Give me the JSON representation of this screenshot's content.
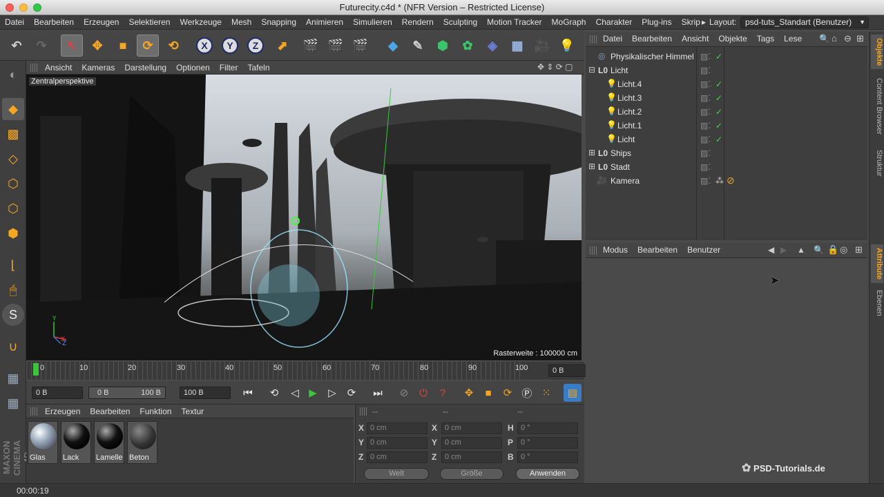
{
  "window": {
    "title": "Futurecity.c4d * (NFR Version – Restricted License)"
  },
  "menubar": {
    "items": [
      "Datei",
      "Bearbeiten",
      "Erzeugen",
      "Selektieren",
      "Werkzeuge",
      "Mesh",
      "Snapping",
      "Animieren",
      "Simulieren",
      "Rendern",
      "Sculpting",
      "Motion Tracker",
      "MoGraph",
      "Charakter",
      "Plug-ins",
      "Skrip"
    ],
    "layout_label": "Layout:",
    "layout_value": "psd-tuts_Standart (Benutzer)"
  },
  "toolbar": {
    "axis_x": "X",
    "axis_y": "Y",
    "axis_z": "Z"
  },
  "viewport": {
    "menu": [
      "Ansicht",
      "Kameras",
      "Darstellung",
      "Optionen",
      "Filter",
      "Tafeln"
    ],
    "label": "Zentralperspektive",
    "raster": "Rasterweite : 100000 cm"
  },
  "timeline": {
    "ticks": [
      "0",
      "10",
      "20",
      "30",
      "40",
      "50",
      "60",
      "70",
      "80",
      "90",
      "100"
    ],
    "current_frame": "0 B"
  },
  "controls": {
    "start": "0 B",
    "range_start": "0 B",
    "range_end": "100 B",
    "end": "100 B"
  },
  "material": {
    "menu": [
      "Erzeugen",
      "Bearbeiten",
      "Funktion",
      "Textur"
    ],
    "items": [
      {
        "name": "Glas"
      },
      {
        "name": "Lack"
      },
      {
        "name": "Lamelle"
      },
      {
        "name": "Beton"
      }
    ]
  },
  "coordinates": {
    "header": [
      "--",
      "--",
      "--"
    ],
    "rows": [
      {
        "label": "X",
        "pos": "0 cm",
        "label2": "X",
        "size": "0 cm",
        "label3": "H",
        "rot": "0 °"
      },
      {
        "label": "Y",
        "pos": "0 cm",
        "label2": "Y",
        "size": "0 cm",
        "label3": "P",
        "rot": "0 °"
      },
      {
        "label": "Z",
        "pos": "0 cm",
        "label2": "Z",
        "size": "0 cm",
        "label3": "B",
        "rot": "0 °"
      }
    ],
    "mode": "Welt",
    "size_mode": "Größe",
    "apply": "Anwenden"
  },
  "objects": {
    "menu": [
      "Datei",
      "Bearbeiten",
      "Ansicht",
      "Objekte",
      "Tags",
      "Lese"
    ],
    "items": [
      {
        "name": "Physikalischer Himmel",
        "indent": 0,
        "check": true
      },
      {
        "name": "Licht",
        "indent": 0,
        "check": false
      },
      {
        "name": "Licht.4",
        "indent": 1,
        "check": true
      },
      {
        "name": "Licht.3",
        "indent": 1,
        "check": true
      },
      {
        "name": "Licht.2",
        "indent": 1,
        "check": true
      },
      {
        "name": "Licht.1",
        "indent": 1,
        "check": true
      },
      {
        "name": "Licht",
        "indent": 1,
        "check": true
      },
      {
        "name": "Ships",
        "indent": 0,
        "check": false
      },
      {
        "name": "Stadt",
        "indent": 0,
        "check": false
      },
      {
        "name": "Kamera",
        "indent": 0,
        "check": false
      }
    ]
  },
  "attributes": {
    "menu": [
      "Modus",
      "Bearbeiten",
      "Benutzer"
    ]
  },
  "right_tabs": [
    "Objekte",
    "Content Browser",
    "Struktur",
    "Attribute",
    "Ebenen"
  ],
  "status": {
    "time": "00:00:19"
  },
  "watermark": {
    "text": "PSD-Tutorials.de"
  },
  "brand": {
    "text": "MAXON CINEMA 4D"
  },
  "colors": {
    "accent": "#f5a623",
    "check": "#4fd24f",
    "axis": "#1a2a6a"
  }
}
